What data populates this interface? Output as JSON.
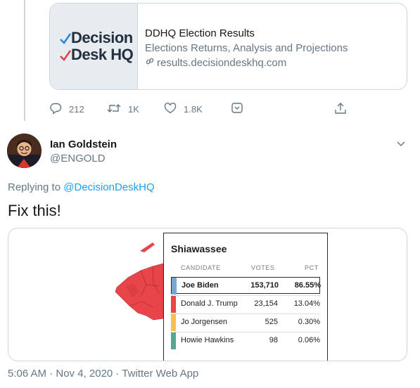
{
  "link_card": {
    "logo_line1": "Decision",
    "logo_line2": "Desk HQ",
    "title": "DDHQ Election Results",
    "description": "Elections Returns, Analysis and Projections",
    "url": "results.decisiondeskhq.com"
  },
  "actions": {
    "reply_count": "212",
    "retweet_count": "1K",
    "like_count": "1.8K"
  },
  "author": {
    "name": "Ian Goldstein",
    "handle": "@ENGOLD"
  },
  "replying": {
    "prefix": "Replying to",
    "mention": "@DecisionDeskHQ"
  },
  "tweet_text": "Fix this!",
  "results": {
    "county": "Shiawassee",
    "headers": {
      "candidate": "CANDIDATE",
      "votes": "VOTES",
      "pct": "PCT"
    },
    "rows": [
      {
        "name": "Joe Biden",
        "votes": "153,710",
        "pct": "86.55%",
        "color": "#7aa6d2"
      },
      {
        "name": "Donald J. Trump",
        "votes": "23,154",
        "pct": "13.04%",
        "color": "#e8454a"
      },
      {
        "name": "Jo Jorgensen",
        "votes": "525",
        "pct": "0.30%",
        "color": "#f2c14e"
      },
      {
        "name": "Howie Hawkins",
        "votes": "98",
        "pct": "0.06%",
        "color": "#5aa58f"
      }
    ]
  },
  "timestamp": "5:06 AM · Nov 4, 2020 · Twitter Web App"
}
